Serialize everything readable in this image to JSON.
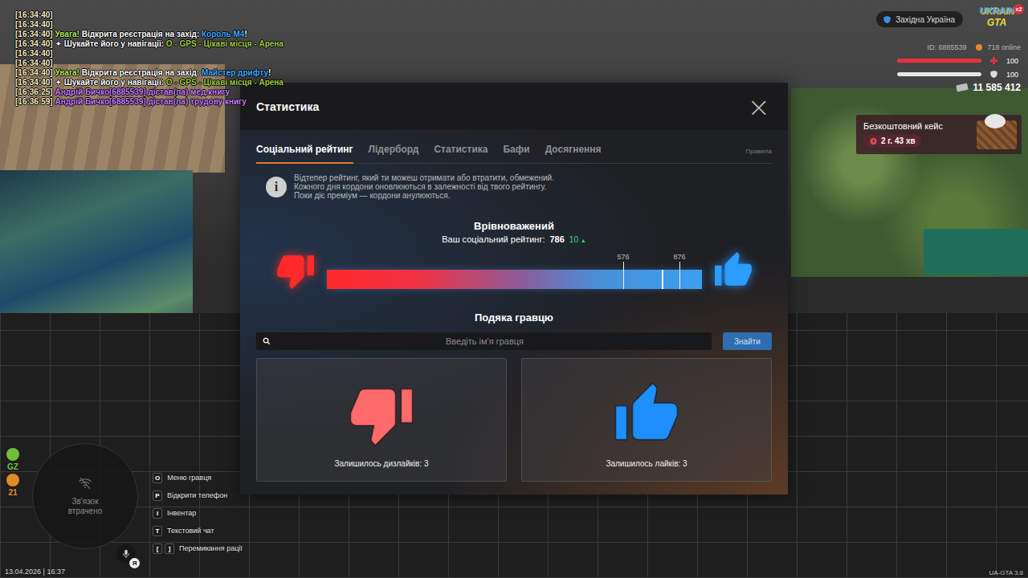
{
  "chat": [
    {
      "segments": [
        {
          "text": "[16:34:40]",
          "color": "#f3e9c6"
        }
      ]
    },
    {
      "segments": [
        {
          "text": "[16:34:40]",
          "color": "#f3e9c6"
        }
      ]
    },
    {
      "segments": [
        {
          "text": "[16:34:40] ",
          "color": "#f3e9c6"
        },
        {
          "text": "Увага!",
          "color": "#b5e655"
        },
        {
          "text": " Відкрита реєстрація на захід: ",
          "color": "#ffffff"
        },
        {
          "text": "Король М4",
          "color": "#3fa9ff"
        },
        {
          "text": "!",
          "color": "#ffffff"
        }
      ]
    },
    {
      "segments": [
        {
          "text": "[16:34:40] ",
          "color": "#f3e9c6"
        },
        {
          "text": "✦ Шукайте його у навігації: ",
          "color": "#ffffff"
        },
        {
          "text": "O - GPS - Цікаві місця - Арена",
          "color": "#9ccc3a"
        }
      ]
    },
    {
      "segments": [
        {
          "text": "[16:34:40]",
          "color": "#f3e9c6"
        }
      ]
    },
    {
      "segments": [
        {
          "text": "[16:34:40]",
          "color": "#f3e9c6"
        }
      ]
    },
    {
      "segments": [
        {
          "text": "[16:34:40] ",
          "color": "#f3e9c6"
        },
        {
          "text": "Увага!",
          "color": "#b5e655"
        },
        {
          "text": " Відкрита реєстрація на захід: ",
          "color": "#ffffff"
        },
        {
          "text": "Майстер дрифту",
          "color": "#3fa9ff"
        },
        {
          "text": "!",
          "color": "#ffffff"
        }
      ]
    },
    {
      "segments": [
        {
          "text": "[16:34:40] ",
          "color": "#f3e9c6"
        },
        {
          "text": "✦ Шукайте його у навігації: ",
          "color": "#ffffff"
        },
        {
          "text": "O - GPS - Цікаві місця - Арена",
          "color": "#9ccc3a"
        }
      ]
    },
    {
      "segments": [
        {
          "text": "[16:36:25] ",
          "color": "#f3e9c6"
        },
        {
          "text": "Андрій Бичко[6885539] дістав(ла) мед.книгу",
          "color": "#c77dff"
        }
      ]
    },
    {
      "segments": [
        {
          "text": "[16:36:59] ",
          "color": "#f3e9c6"
        },
        {
          "text": "Андрій Бичко[6885539] дістав(ла) трудову книгу",
          "color": "#c77dff"
        }
      ]
    }
  ],
  "hud": {
    "server": "Західна Україна",
    "logo": {
      "top": "UKRAIN",
      "bottom": "GTA",
      "badge": "x2"
    },
    "id": "ID: 6885539",
    "online": "718 online",
    "stats": [
      {
        "kind": "health",
        "value": "100",
        "level": 1
      },
      {
        "kind": "armor",
        "value": "100",
        "level": 1
      }
    ],
    "money": "11 585 412",
    "case": {
      "title": "Безкоштовний кейс",
      "timer": "2 г. 43 хв"
    }
  },
  "window": {
    "title": "Статистика",
    "close": "×"
  },
  "tabs": [
    {
      "label": "Соціальний рейтинг",
      "selected": true
    },
    {
      "label": "Лідерборд",
      "selected": false
    },
    {
      "label": "Статистика",
      "selected": false
    },
    {
      "label": "Бафи",
      "selected": false
    },
    {
      "label": "Досягнення",
      "selected": false
    }
  ],
  "rules_link": "Правила",
  "info": {
    "icon": "i",
    "lines": [
      "Відтепер рейтинг, який ти можеш отримати або втратити, обмежений.",
      "Кожного дня кордони оновлюються в залежності від твого рейтингу.",
      "Поки діє преміум — кордони анулюються."
    ]
  },
  "rating": {
    "status": "Врівноважений",
    "label": "Ваш соціальний рейтинг:",
    "value": "786",
    "change": "10",
    "change_icon": "▲",
    "level": 0.893,
    "markers": [
      {
        "label": "576",
        "level": 0.79
      },
      {
        "label": "876",
        "level": 0.94
      }
    ]
  },
  "thanks": {
    "title": "Подяка гравцю",
    "search": {
      "placeholder": "Введіть ім'я гравця"
    },
    "button": "Знайти",
    "cards": [
      {
        "kind": "dislike",
        "text": "Залишилось дизлайків: 3"
      },
      {
        "kind": "like",
        "text": "Залишилось лайків: 3"
      }
    ]
  },
  "hud_left": {
    "zones": [
      {
        "kind": "greenzone",
        "label": "GZ",
        "color": "#6fbf3a"
      },
      {
        "kind": "wanted",
        "label": "21",
        "color": "#e08a2a"
      }
    ],
    "minimap": {
      "status": "Зв'язок втрачено"
    },
    "hints": [
      {
        "keys": [
          "O"
        ],
        "label": "Меню гравця"
      },
      {
        "keys": [
          "P"
        ],
        "label": "Відкрити телефон"
      },
      {
        "keys": [
          "I"
        ],
        "label": "Інвентар"
      },
      {
        "keys": [
          "T"
        ],
        "label": "Текстовий чат"
      },
      {
        "keys": [
          "[",
          "]"
        ],
        "label": "Перемикання рації"
      }
    ],
    "datetime": "13.04.2026 | 16:37",
    "voice": "Я"
  },
  "version": "UA-GTA 3.8"
}
